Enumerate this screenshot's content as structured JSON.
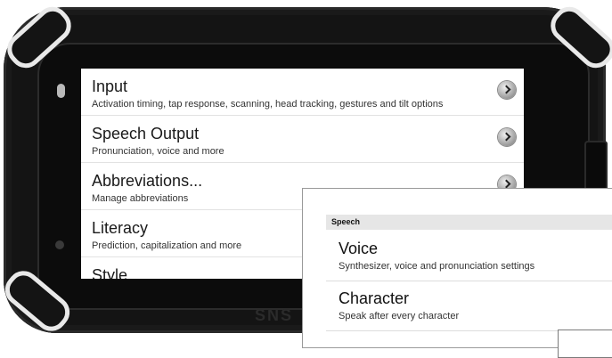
{
  "device": {
    "brand_text": "SNS"
  },
  "settings_list": {
    "items": [
      {
        "title": "Input",
        "subtitle": "Activation timing, tap response, scanning, head tracking, gestures and tilt options"
      },
      {
        "title": "Speech Output",
        "subtitle": "Pronunciation, voice and more"
      },
      {
        "title": "Abbreviations...",
        "subtitle": "Manage abbreviations"
      },
      {
        "title": "Literacy",
        "subtitle": "Prediction, capitalization and more"
      },
      {
        "title": "Style",
        "subtitle": ""
      }
    ]
  },
  "speech_panel": {
    "header": "Speech",
    "items": [
      {
        "title": "Voice",
        "subtitle": "Synthesizer, voice and pronunciation settings"
      },
      {
        "title": "Character",
        "subtitle": "Speak after every character"
      }
    ]
  },
  "icons": {
    "chevron": "chevron-right-circle-icon"
  }
}
